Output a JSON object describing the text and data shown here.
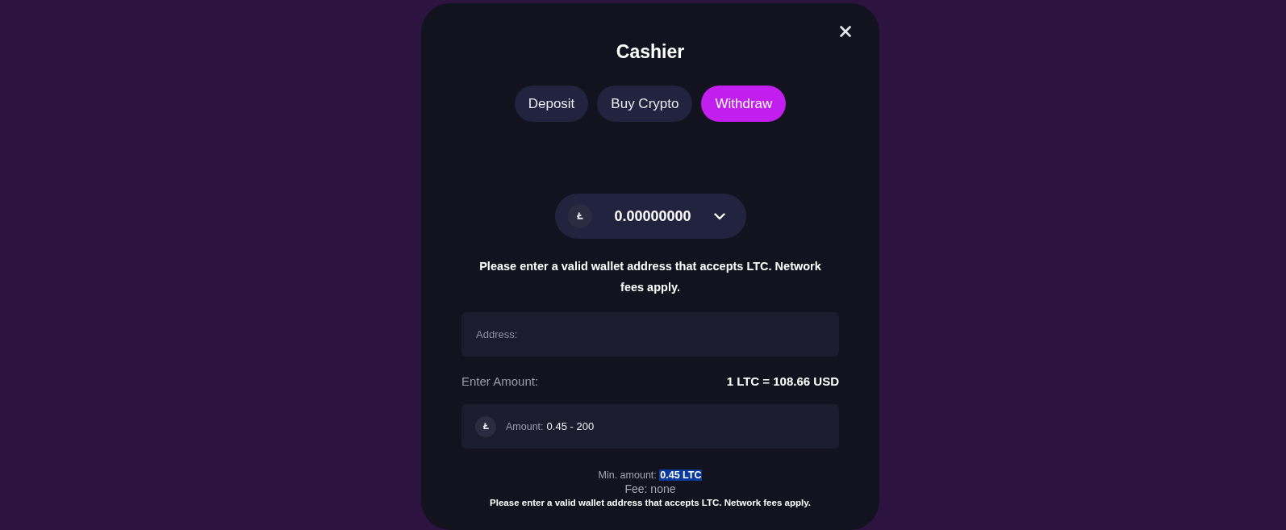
{
  "dialog": {
    "title": "Cashier"
  },
  "tabs": [
    {
      "label": "Deposit",
      "selected": false
    },
    {
      "label": "Buy Crypto",
      "selected": false
    },
    {
      "label": "Withdraw",
      "selected": true
    }
  ],
  "balance": {
    "value": "0.00000000"
  },
  "notice": "Please enter a valid wallet address that accepts LTC. Network fees apply.",
  "address_field": {
    "placeholder": "Address:"
  },
  "amount_label": "Enter Amount:",
  "rate": "1 LTC = 108.66 USD",
  "amount_field": {
    "label": "Amount:",
    "placeholder": "0.45 - 200"
  },
  "min_amount": {
    "label": "Min. amount:",
    "value": "0.45 LTC",
    "highlighted": true
  },
  "fee": "Fee: none",
  "footer_note": "Please enter a valid wallet address that accepts LTC. Network fees apply."
}
